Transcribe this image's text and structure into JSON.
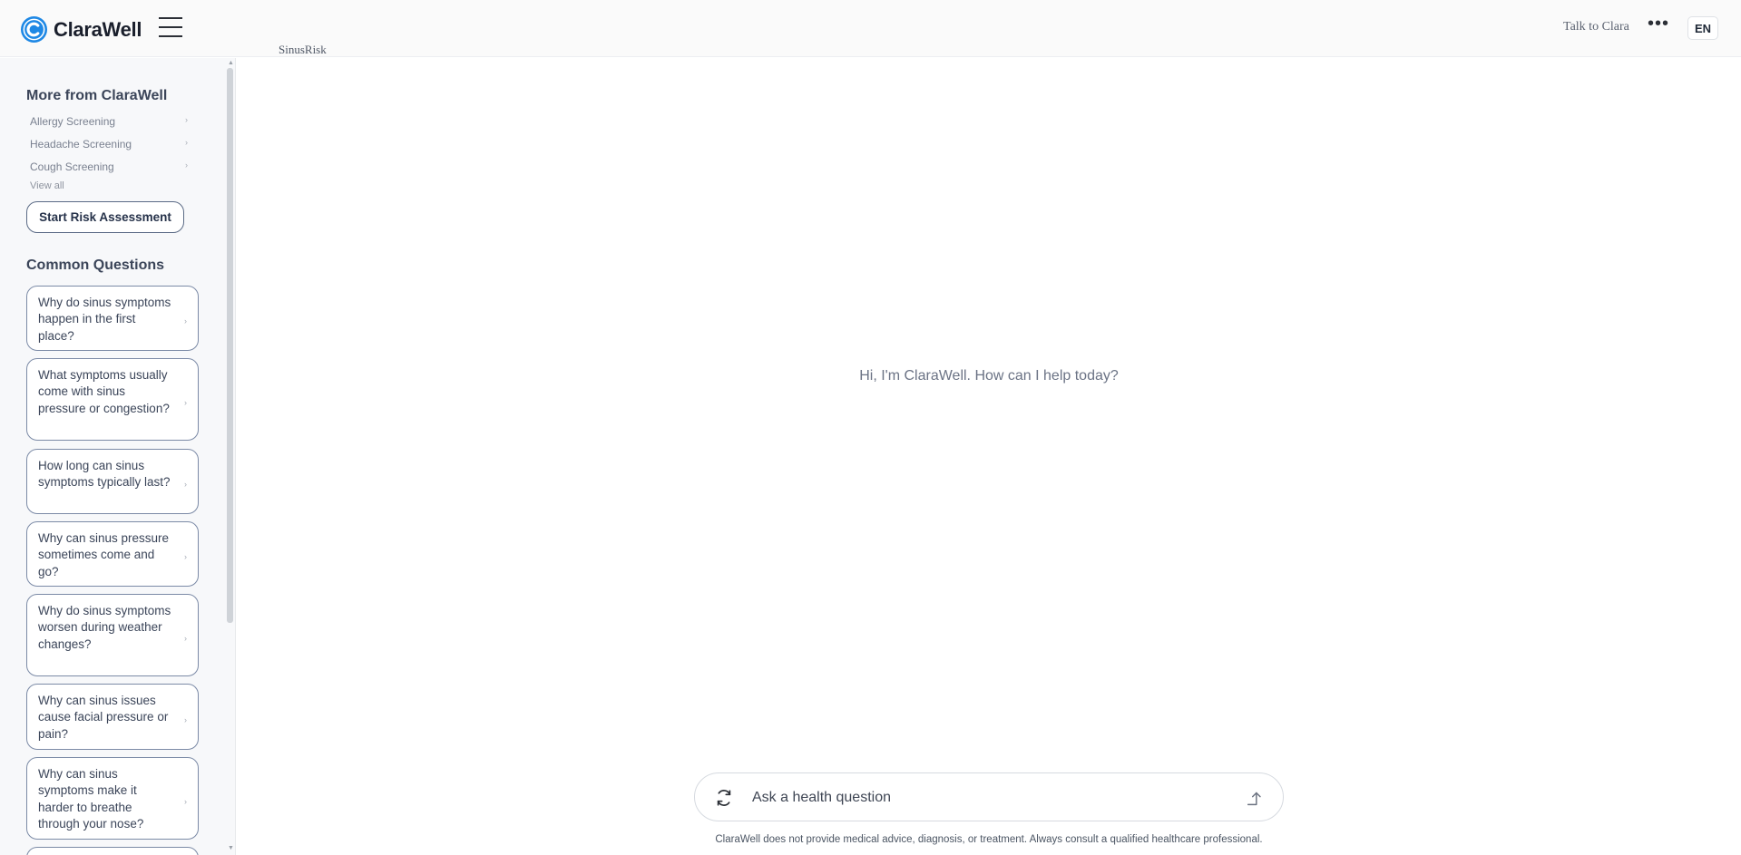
{
  "header": {
    "brand": "ClaraWell",
    "page_label": "SinusRisk",
    "talk_link": "Talk to Clara",
    "more_label": "•••",
    "language": "EN"
  },
  "sidebar": {
    "more_title": "More from ClaraWell",
    "more_items": [
      {
        "label": "Allergy Screening",
        "chevron": "›"
      },
      {
        "label": "Headache Screening",
        "chevron": "›"
      },
      {
        "label": "Cough Screening",
        "chevron": "›"
      }
    ],
    "view_all": "View all",
    "start_button": "Start Risk Assessment",
    "questions_title": "Common Questions",
    "questions": [
      {
        "label": "Why do sinus symptoms happen in the first place?",
        "chevron": "›"
      },
      {
        "label": "What symptoms usually come with sinus pressure or congestion?",
        "chevron": "›"
      },
      {
        "label": "How long can sinus symptoms typically last?",
        "chevron": "›"
      },
      {
        "label": "Why can sinus pressure sometimes come and go?",
        "chevron": "›"
      },
      {
        "label": "Why do sinus symptoms worsen during weather changes?",
        "chevron": "›"
      },
      {
        "label": "Why can sinus issues cause facial pressure or pain?",
        "chevron": "›"
      },
      {
        "label": "Why can sinus symptoms make it harder to breathe through your nose?",
        "chevron": "›"
      }
    ],
    "scroll_up": "▲",
    "scroll_down": "▼"
  },
  "main": {
    "greeting": "Hi, I'm ClaraWell. How can I help today?"
  },
  "composer": {
    "placeholder": "Ask a health question",
    "value": "",
    "disclaimer": "ClaraWell does not provide medical advice, diagnosis, or treatment. Always consult a qualified healthcare professional."
  },
  "colors": {
    "brand_blue": "#1e88e5",
    "accent_border": "#7b8aa6"
  },
  "icons": {
    "logo": "clarawell-logo-icon",
    "menu": "hamburger-menu-icon",
    "refresh": "refresh-icon",
    "send": "send-arrow-icon"
  }
}
